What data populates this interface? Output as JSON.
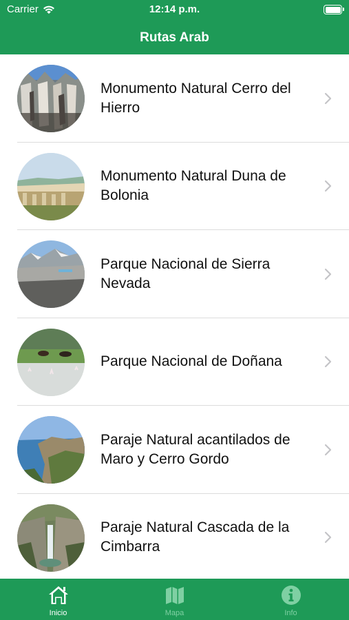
{
  "status_bar": {
    "carrier": "Carrier",
    "time": "12:14 p.m."
  },
  "header": {
    "title": "Rutas Arab"
  },
  "routes": [
    {
      "title": "Monumento Natural Cerro del Hierro"
    },
    {
      "title": "Monumento Natural Duna de Bolonia"
    },
    {
      "title": "Parque Nacional de Sierra Nevada"
    },
    {
      "title": "Parque Nacional de Doñana"
    },
    {
      "title": "Paraje Natural acantilados de Maro y Cerro Gordo"
    },
    {
      "title": "Paraje Natural Cascada de la Cimbarra"
    }
  ],
  "tabs": [
    {
      "label": "Inicio",
      "icon": "home-icon",
      "active": true
    },
    {
      "label": "Mapa",
      "icon": "map-icon",
      "active": false
    },
    {
      "label": "Info",
      "icon": "info-icon",
      "active": false
    }
  ],
  "colors": {
    "brand": "#1e9a57",
    "tab_inactive": "#7fd0a3",
    "separator": "#dcdcdc",
    "chevron": "#c4c4c7"
  }
}
